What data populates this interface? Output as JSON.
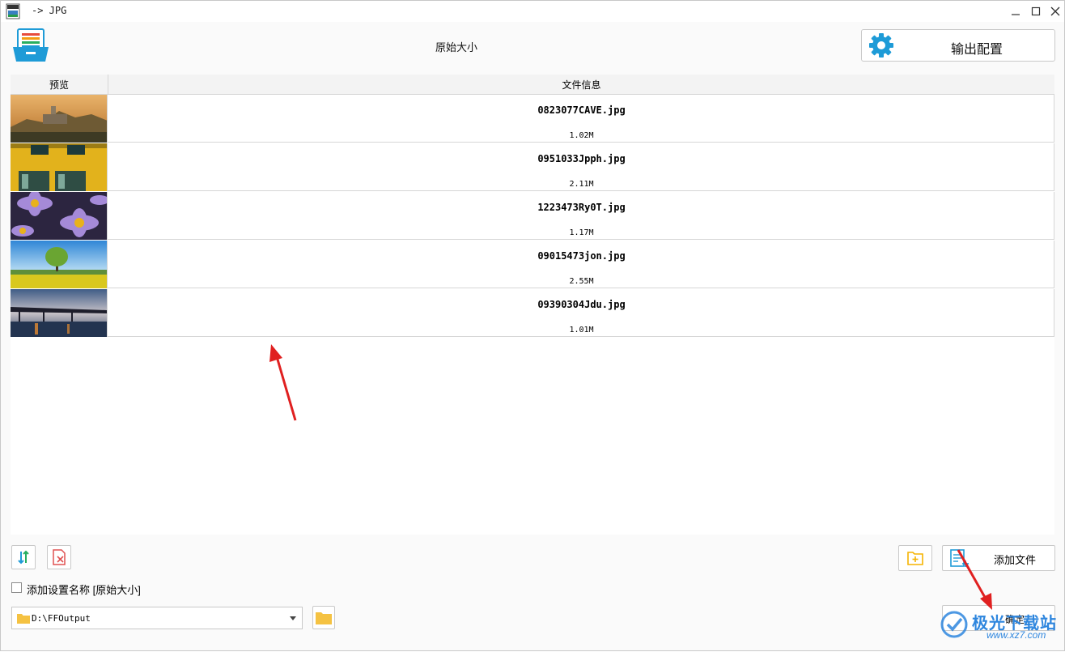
{
  "window": {
    "title": "-> JPG",
    "app_icon_label": "JPEG"
  },
  "header": {
    "title": "原始大小",
    "output_button_label": "输出配置"
  },
  "table": {
    "columns": [
      "预览",
      "文件信息"
    ],
    "rows": [
      {
        "filename": "0823077CAVE.jpg",
        "size": "1.02M",
        "thumb": "castle-sunset"
      },
      {
        "filename": "0951033Jpph.jpg",
        "size": "2.11M",
        "thumb": "yellow-windows"
      },
      {
        "filename": "1223473Ry0T.jpg",
        "size": "1.17M",
        "thumb": "purple-daisies"
      },
      {
        "filename": "09015473jon.jpg",
        "size": "2.55M",
        "thumb": "tree-field"
      },
      {
        "filename": "09390304Jdu.jpg",
        "size": "1.01M",
        "thumb": "bridge-night"
      }
    ]
  },
  "bottom": {
    "add_files_label": "添加文件",
    "checkbox_label": "添加设置名称 [原始大小]",
    "checkbox_checked": false,
    "output_path": "D:\\FFOutput",
    "ok_label": "确定"
  },
  "watermark": {
    "text": "极光下载站",
    "url": "www.xz7.com"
  },
  "colors": {
    "accent_blue": "#1e9bd7",
    "annotation_red": "#e02020",
    "folder_yellow": "#f5b400"
  }
}
